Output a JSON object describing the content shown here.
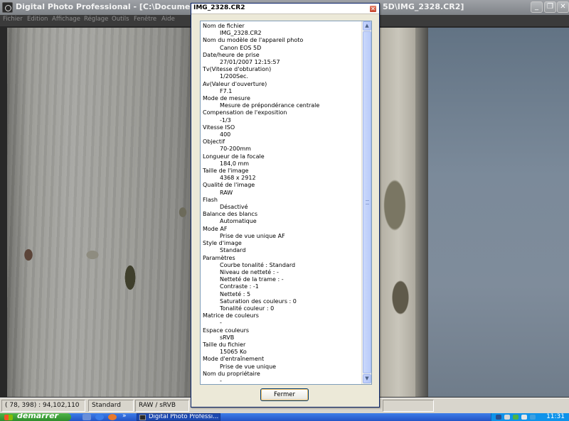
{
  "app": {
    "title": "Digital Photo Professional - [C:\\Documents and Setti",
    "title_tail": "5D\\IMG_2328.CR2]",
    "window_buttons": {
      "minimize": "_",
      "restore": "❐",
      "close": "✕"
    }
  },
  "menu": {
    "items": [
      "Fichier",
      "Edition",
      "Affichage",
      "Réglage",
      "Outils",
      "Fenêtre",
      "Aide"
    ]
  },
  "statusbar": {
    "coords": "( 78, 398) : 94,102,110",
    "style": "Standard",
    "format": "RAW / sRVB"
  },
  "dialog": {
    "title": "IMG_2328.CR2",
    "close_glyph": "✕",
    "button_label": "Fermer",
    "info": [
      {
        "label": "Nom de fichier",
        "values": [
          "IMG_2328.CR2"
        ]
      },
      {
        "label": "Nom du modèle de l'appareil photo",
        "values": [
          "Canon EOS 5D"
        ]
      },
      {
        "label": "Date/heure de prise",
        "values": [
          "27/01/2007 12:15:57"
        ]
      },
      {
        "label": "Tv(Vitesse d'obturation)",
        "values": [
          "1/200Sec."
        ]
      },
      {
        "label": "Av(Valeur d'ouverture)",
        "values": [
          "F7.1"
        ]
      },
      {
        "label": "Mode de mesure",
        "values": [
          "Mesure de prépondérance centrale"
        ]
      },
      {
        "label": "Compensation de l'exposition",
        "values": [
          "-1/3"
        ]
      },
      {
        "label": "Vitesse ISO",
        "values": [
          "400"
        ]
      },
      {
        "label": "Objectif",
        "values": [
          "70-200mm"
        ]
      },
      {
        "label": "Longueur de la focale",
        "values": [
          "184,0 mm"
        ]
      },
      {
        "label": "Taille de l'image",
        "values": [
          "4368 x 2912"
        ]
      },
      {
        "label": "Qualité de l'image",
        "values": [
          "RAW"
        ]
      },
      {
        "label": "Flash",
        "values": [
          "Désactivé"
        ]
      },
      {
        "label": "Balance des blancs",
        "values": [
          "Automatique"
        ]
      },
      {
        "label": "Mode AF",
        "values": [
          "Prise de vue unique AF"
        ]
      },
      {
        "label": "Style d'image",
        "values": [
          "Standard"
        ]
      },
      {
        "label": "Paramètres",
        "values": [
          "Courbe tonalité :   Standard",
          "Niveau de netteté :   -",
          "Netteté de la trame :   -",
          "Contraste :   -1",
          "Netteté :   5",
          "Saturation des couleurs :   0",
          "Tonalité couleur :   0"
        ]
      },
      {
        "label": "Matrice de couleurs",
        "values": [
          "-"
        ]
      },
      {
        "label": "Espace couleurs",
        "values": [
          "sRVB"
        ]
      },
      {
        "label": "Taille du fichier",
        "values": [
          "15065 Ko"
        ]
      },
      {
        "label": "Mode d'entraînement",
        "values": [
          "Prise de vue unique"
        ]
      },
      {
        "label": "Nom du propriétaire",
        "values": [
          "-"
        ]
      }
    ],
    "scroll_up": "▲",
    "scroll_down": "▼"
  },
  "taskbar": {
    "start_label": "démarrer",
    "quicklaunch_more": "»",
    "task_button": "Digital Photo Professi...",
    "clock": "11:31"
  }
}
